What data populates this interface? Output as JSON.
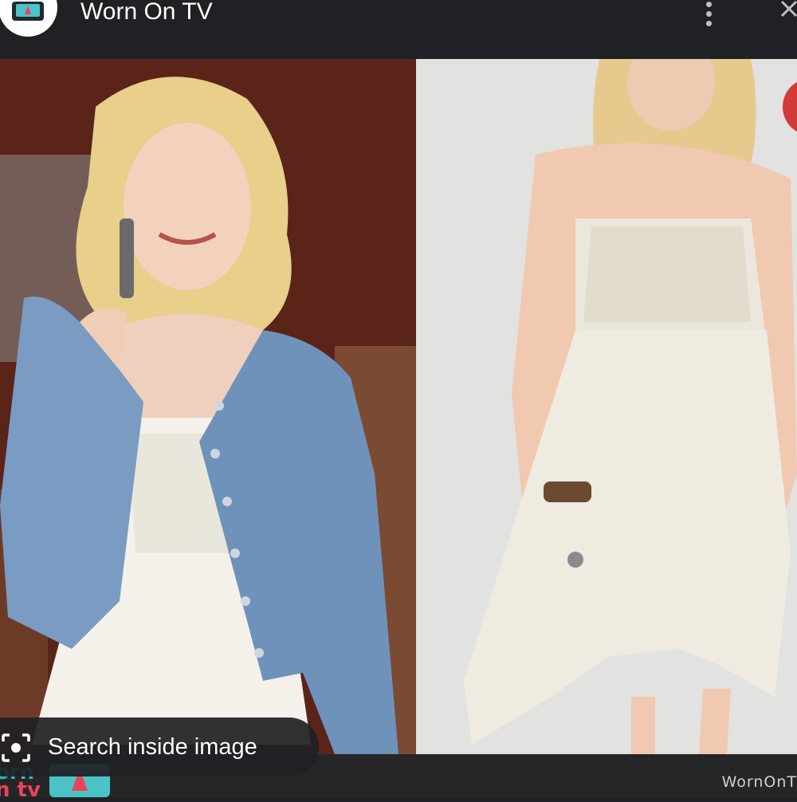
{
  "header": {
    "site_title": "Worn On TV",
    "site_icon": "tv-dress-logo-icon",
    "menu_icon": "more-vert-icon",
    "close_icon": "close-icon"
  },
  "images": {
    "left": "woman-in-denim-jacket-and-white-dress-photo",
    "right": "model-in-white-lace-dress-product-photo"
  },
  "overlay": {
    "search_label": "Search inside image",
    "search_icon": "lens-icon"
  },
  "footer": {
    "logo_text_line1": "orn",
    "logo_text_line2": "n tv",
    "watermark": "WornOnT"
  },
  "colors": {
    "header_bg": "#202124",
    "brand_teal": "#4cc3c7",
    "brand_pink": "#e8435b"
  }
}
